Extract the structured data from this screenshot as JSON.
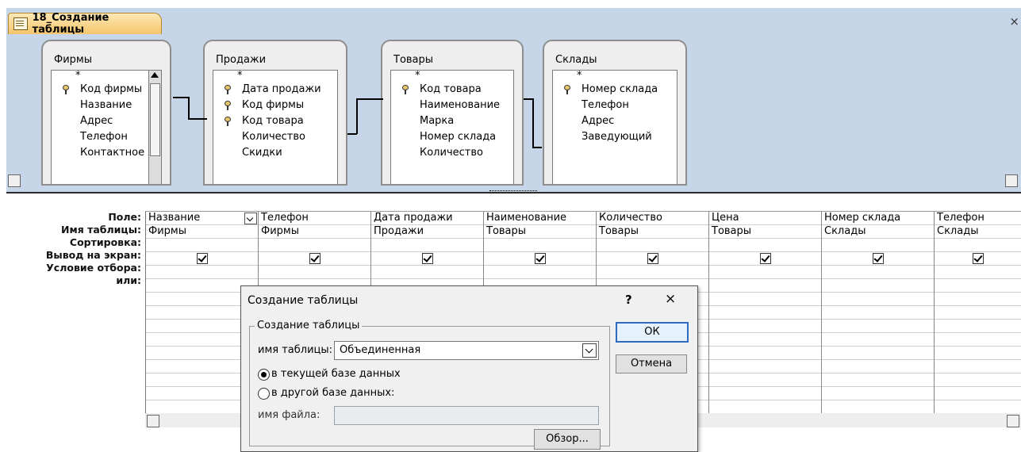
{
  "window": {
    "tab_title": "18_Создание таблицы",
    "close_glyph": "×"
  },
  "tables": [
    {
      "title": "Фирмы",
      "fields": [
        {
          "name": "*",
          "key": false
        },
        {
          "name": "Код фирмы",
          "key": true
        },
        {
          "name": "Название",
          "key": false
        },
        {
          "name": "Адрес",
          "key": false
        },
        {
          "name": "Телефон",
          "key": false
        },
        {
          "name": "Контактное ли",
          "key": false
        }
      ]
    },
    {
      "title": "Продажи",
      "fields": [
        {
          "name": "*",
          "key": false
        },
        {
          "name": "Дата продажи",
          "key": true
        },
        {
          "name": "Код фирмы",
          "key": true
        },
        {
          "name": "Код товара",
          "key": true
        },
        {
          "name": "Количество",
          "key": false
        },
        {
          "name": "Скидки",
          "key": false
        }
      ]
    },
    {
      "title": "Товары",
      "fields": [
        {
          "name": "*",
          "key": false
        },
        {
          "name": "Код товара",
          "key": true
        },
        {
          "name": "Наименование",
          "key": false
        },
        {
          "name": "Марка",
          "key": false
        },
        {
          "name": "Номер склада",
          "key": false
        },
        {
          "name": "Количество",
          "key": false
        }
      ]
    },
    {
      "title": "Склады",
      "fields": [
        {
          "name": "*",
          "key": false
        },
        {
          "name": "Номер склада",
          "key": true
        },
        {
          "name": "Телефон",
          "key": false
        },
        {
          "name": "Адрес",
          "key": false
        },
        {
          "name": "Заведующий",
          "key": false
        }
      ]
    }
  ],
  "grid": {
    "row_labels": [
      "Поле:",
      "Имя таблицы:",
      "Сортировка:",
      "Вывод на экран:",
      "Условие отбора:",
      "или:"
    ],
    "columns": [
      {
        "field": "Название",
        "table": "Фирмы",
        "show": true
      },
      {
        "field": "Телефон",
        "table": "Фирмы",
        "show": true
      },
      {
        "field": "Дата продажи",
        "table": "Продажи",
        "show": true
      },
      {
        "field": "Наименование",
        "table": "Товары",
        "show": true
      },
      {
        "field": "Количество",
        "table": "Товары",
        "show": true
      },
      {
        "field": "Цена",
        "table": "Товары",
        "show": true
      },
      {
        "field": "Номер склада",
        "table": "Склады",
        "show": true
      },
      {
        "field": "Телефон",
        "table": "Склады",
        "show": true
      }
    ]
  },
  "dialog": {
    "title": "Создание таблицы",
    "help": "?",
    "close": "×",
    "group_label": "Создание таблицы",
    "name_label": "имя таблицы:",
    "name_value": "Объединенная",
    "radio_current": "в текущей базе данных",
    "radio_other": "в другой базе данных:",
    "file_label": "имя файла:",
    "file_value": "",
    "browse": "Обзор...",
    "ok": "ОК",
    "cancel": "Отмена"
  },
  "colors": {
    "designer_bg": "#c6d5e8",
    "tab_bg": "#f5c56a",
    "ok_border": "#2d6bc4"
  }
}
